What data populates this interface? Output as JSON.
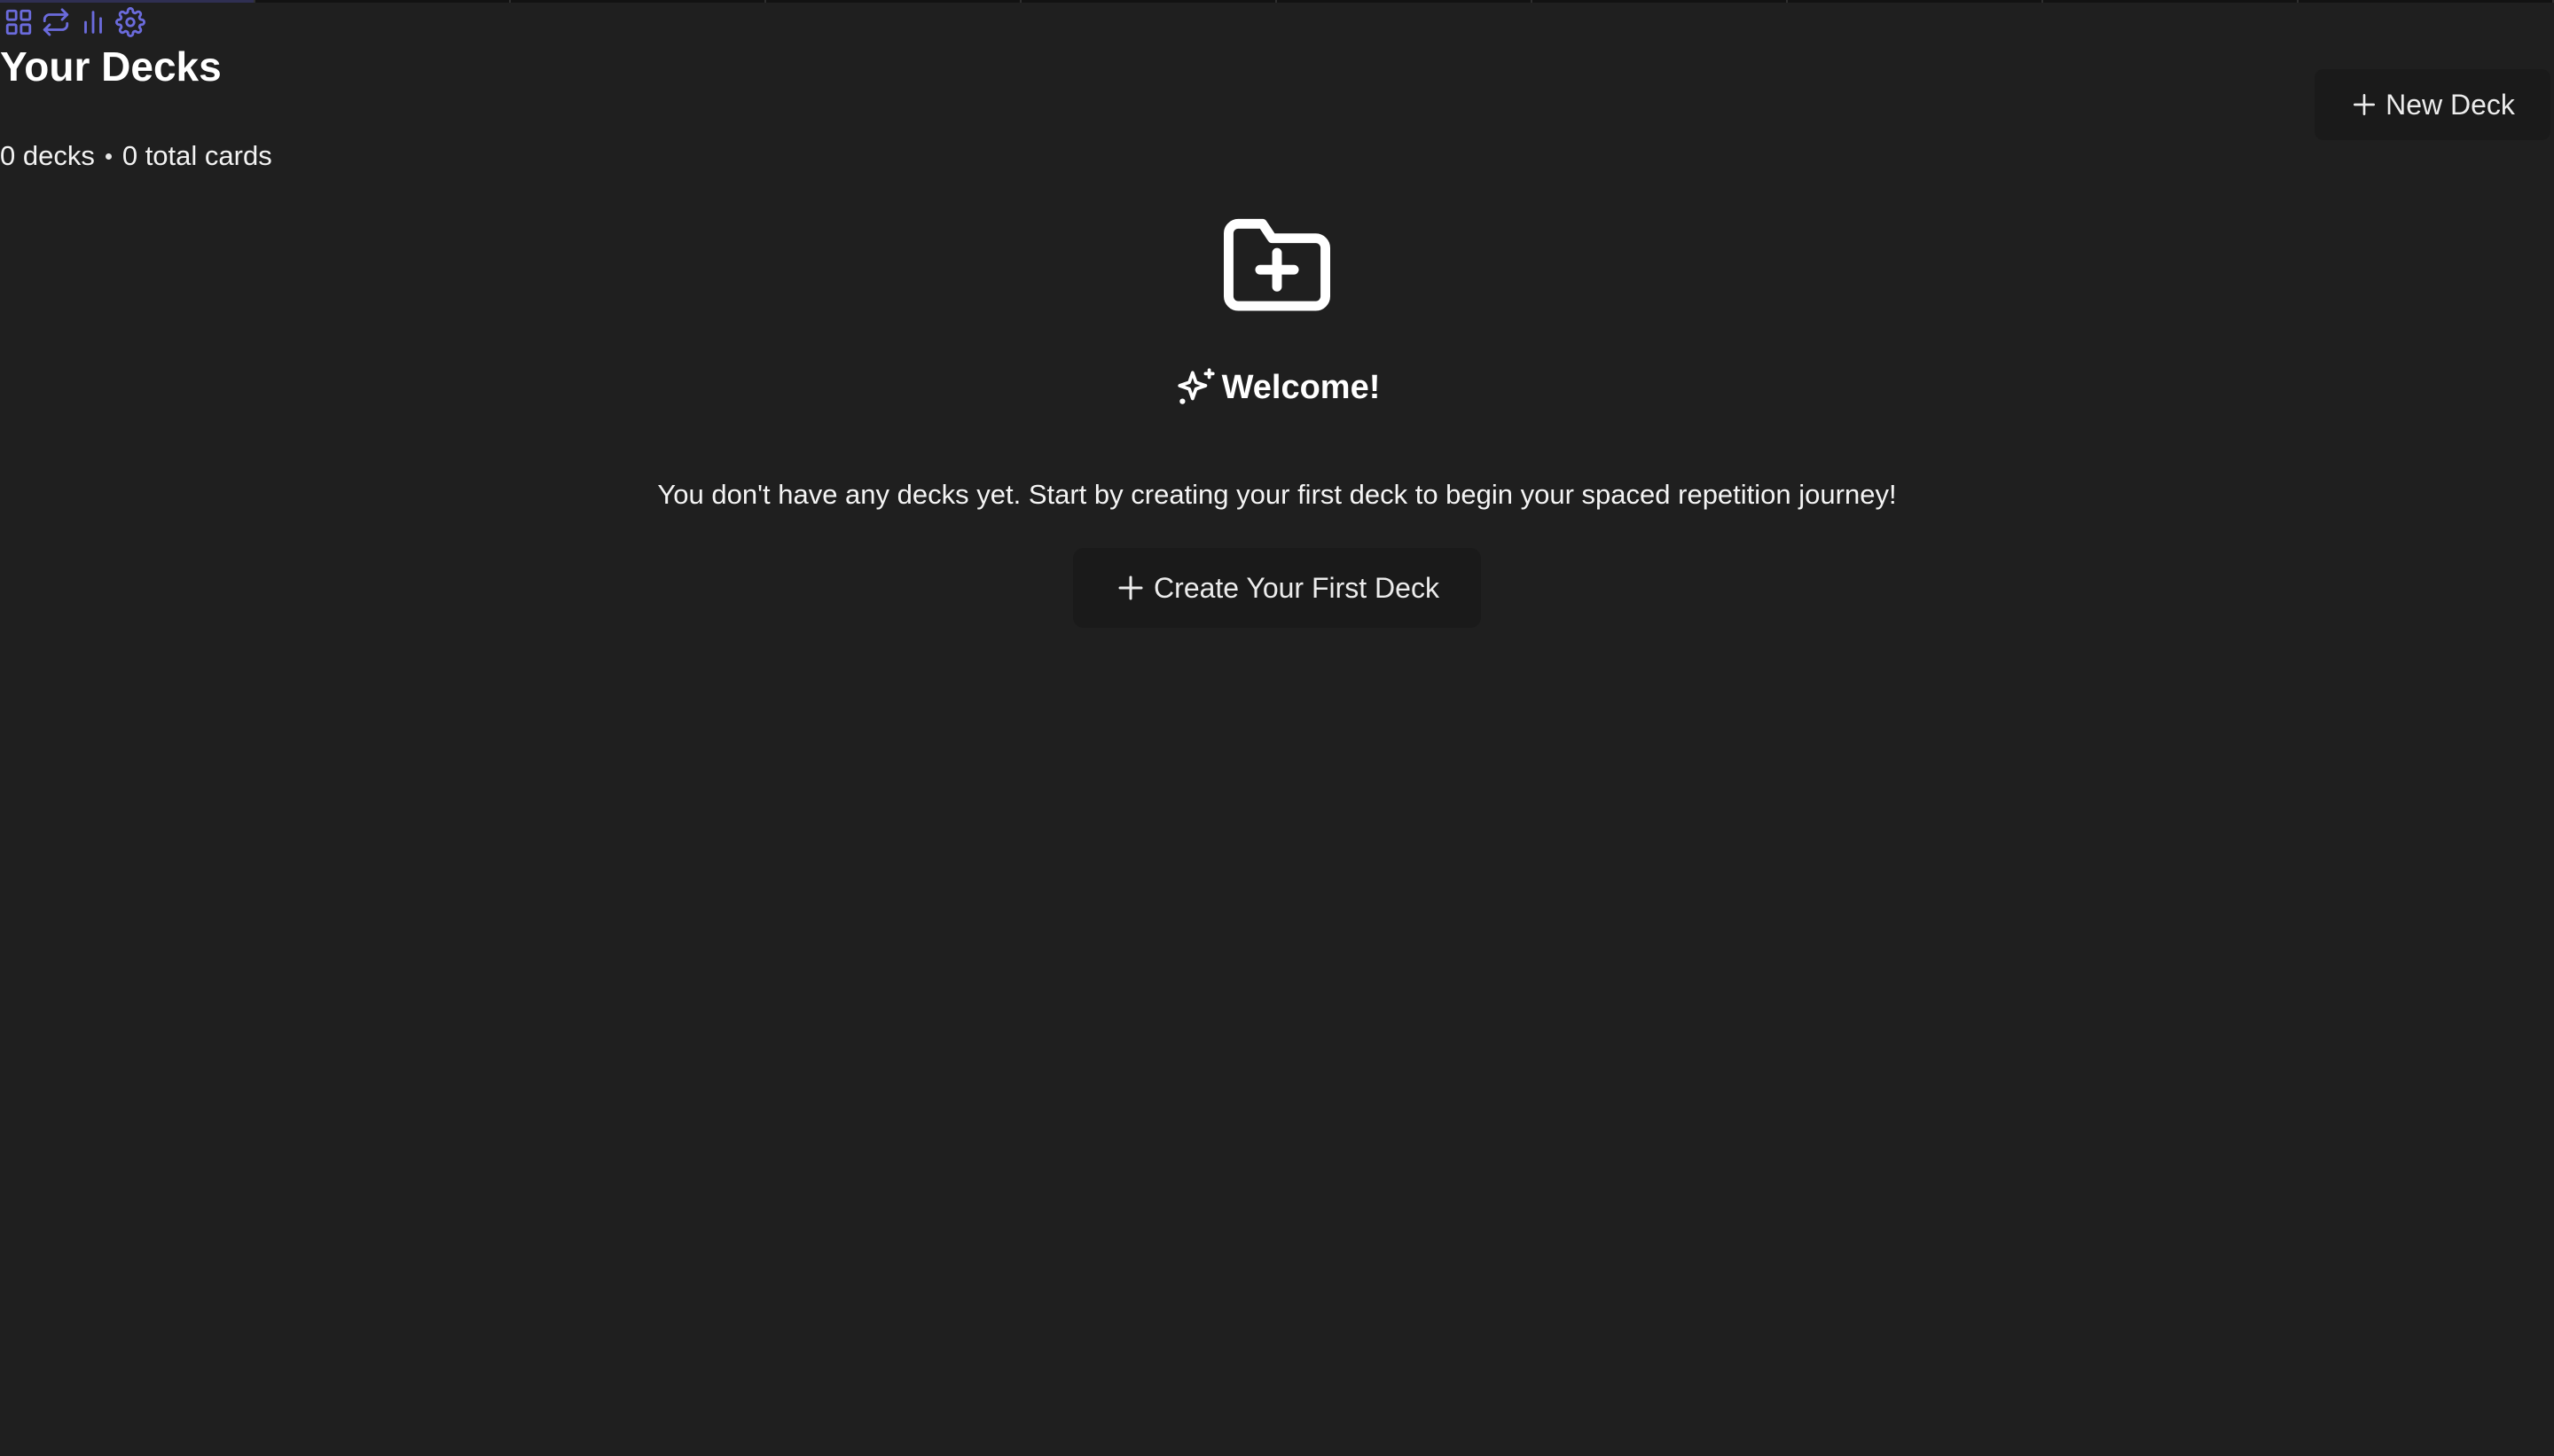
{
  "app": {
    "accent_color": "#6b6bdc",
    "background_color": "#1f1f1f"
  },
  "toolbar": {
    "items": [
      {
        "icon": "grid-icon"
      },
      {
        "icon": "repeat-icon"
      },
      {
        "icon": "bar-chart-icon"
      },
      {
        "icon": "gear-icon"
      }
    ]
  },
  "header": {
    "title": "Your Decks",
    "deck_count": "0 decks",
    "card_count": "0 total cards",
    "new_deck_label": "New Deck"
  },
  "empty_state": {
    "icon": "folder-plus-icon",
    "sparkle_icon": "sparkles-icon",
    "title": "Welcome!",
    "description": "You don't have any decks yet. Start by creating your first deck to begin your spaced repetition journey!",
    "create_label": "Create Your First Deck"
  }
}
